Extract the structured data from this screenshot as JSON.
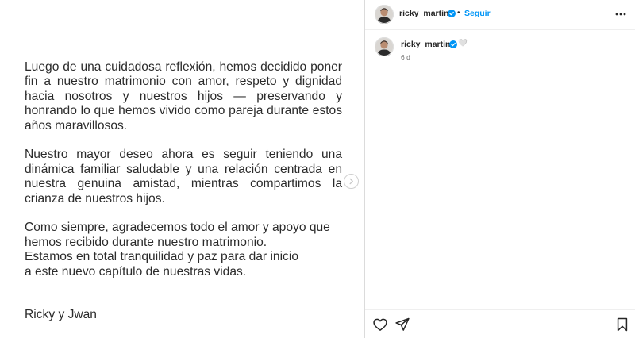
{
  "post": {
    "paragraph1": "Luego de una cuidadosa reflexión, hemos decidido poner fin a nuestro matrimonio con amor, respeto y dignidad hacia nosotros y nuestros hijos — preservando y honrando lo que hemos vivido como pareja durante estos años maravillosos.",
    "paragraph2": "Nuestro mayor deseo ahora es seguir teniendo una dinámica familiar saludable y una relación centrada en nuestra genuina amistad, mientras compartimos la crianza de nuestros hijos.",
    "paragraph3_line1": "Como siempre, agradecemos todo el amor y apoyo que",
    "paragraph3_line2": "hemos recibido durante nuestro matrimonio.",
    "paragraph3_line3": "Estamos en total tranquilidad y paz para dar inicio",
    "paragraph3_line4": "a este nuevo capítulo de nuestras vidas.",
    "signature": "Ricky y Jwan"
  },
  "header": {
    "username": "ricky_martin",
    "separator": "•",
    "follow_label": "Seguir"
  },
  "caption": {
    "username": "ricky_martin",
    "emoji": "🤍",
    "time": "6 d"
  },
  "colors": {
    "accent": "#0095f6",
    "verified": "#0095f6",
    "border": "#dbdbdb"
  },
  "icons": {
    "more": "more-options-icon",
    "next": "chevron-right-icon",
    "like": "heart-icon",
    "share": "paper-plane-icon",
    "save": "bookmark-icon"
  }
}
